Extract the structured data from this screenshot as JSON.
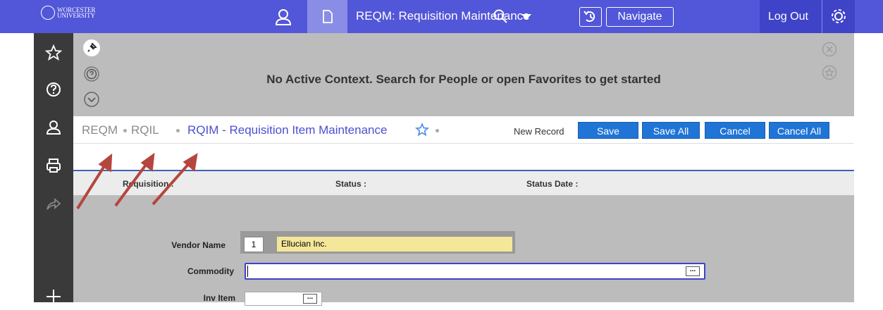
{
  "header": {
    "logo_line1": "WORCESTER",
    "logo_line2": "UNIVERSITY",
    "form_title": "REQM: Requisition Maintenance",
    "navigate_label": "Navigate",
    "logout_label": "Log Out"
  },
  "icons": {
    "user": "user-icon",
    "document": "document-icon",
    "search": "search-icon",
    "dropdown": "chevron-down-icon",
    "history": "history-icon",
    "settings": "gear-icon",
    "favorites": "star-icon",
    "help": "question-icon",
    "print": "printer-icon",
    "share": "share-icon",
    "add": "plus-icon",
    "pin": "pin-icon",
    "close": "close-icon"
  },
  "context": {
    "message": "No Active Context. Search for People or open Favorites to get started"
  },
  "breadcrumb": {
    "items": [
      "REQM",
      "RQIL",
      "RQIM - Requisition Item Maintenance"
    ]
  },
  "toolbar": {
    "new_record": "New Record",
    "save": "Save",
    "save_all": "Save All",
    "cancel": "Cancel",
    "cancel_all": "Cancel All"
  },
  "key_block": {
    "requisition_label": "Requisition :",
    "status_label": "Status :",
    "status_date_label": "Status Date :"
  },
  "form": {
    "vendor_label": "Vendor Name",
    "vendor_number": "1",
    "vendor_name": "Ellucian Inc.",
    "commodity_label": "Commodity",
    "commodity_value": "",
    "inv_item_label": "Inv Item",
    "ellipsis": "..."
  },
  "colors": {
    "header": "#5256d8",
    "accent": "#4b4fd0",
    "button": "#1f74d6",
    "sidebar": "#3a3a3a",
    "panel": "#bcbcbc",
    "vendor_highlight": "#f4e79a",
    "annotation_arrow": "#b5463f"
  }
}
